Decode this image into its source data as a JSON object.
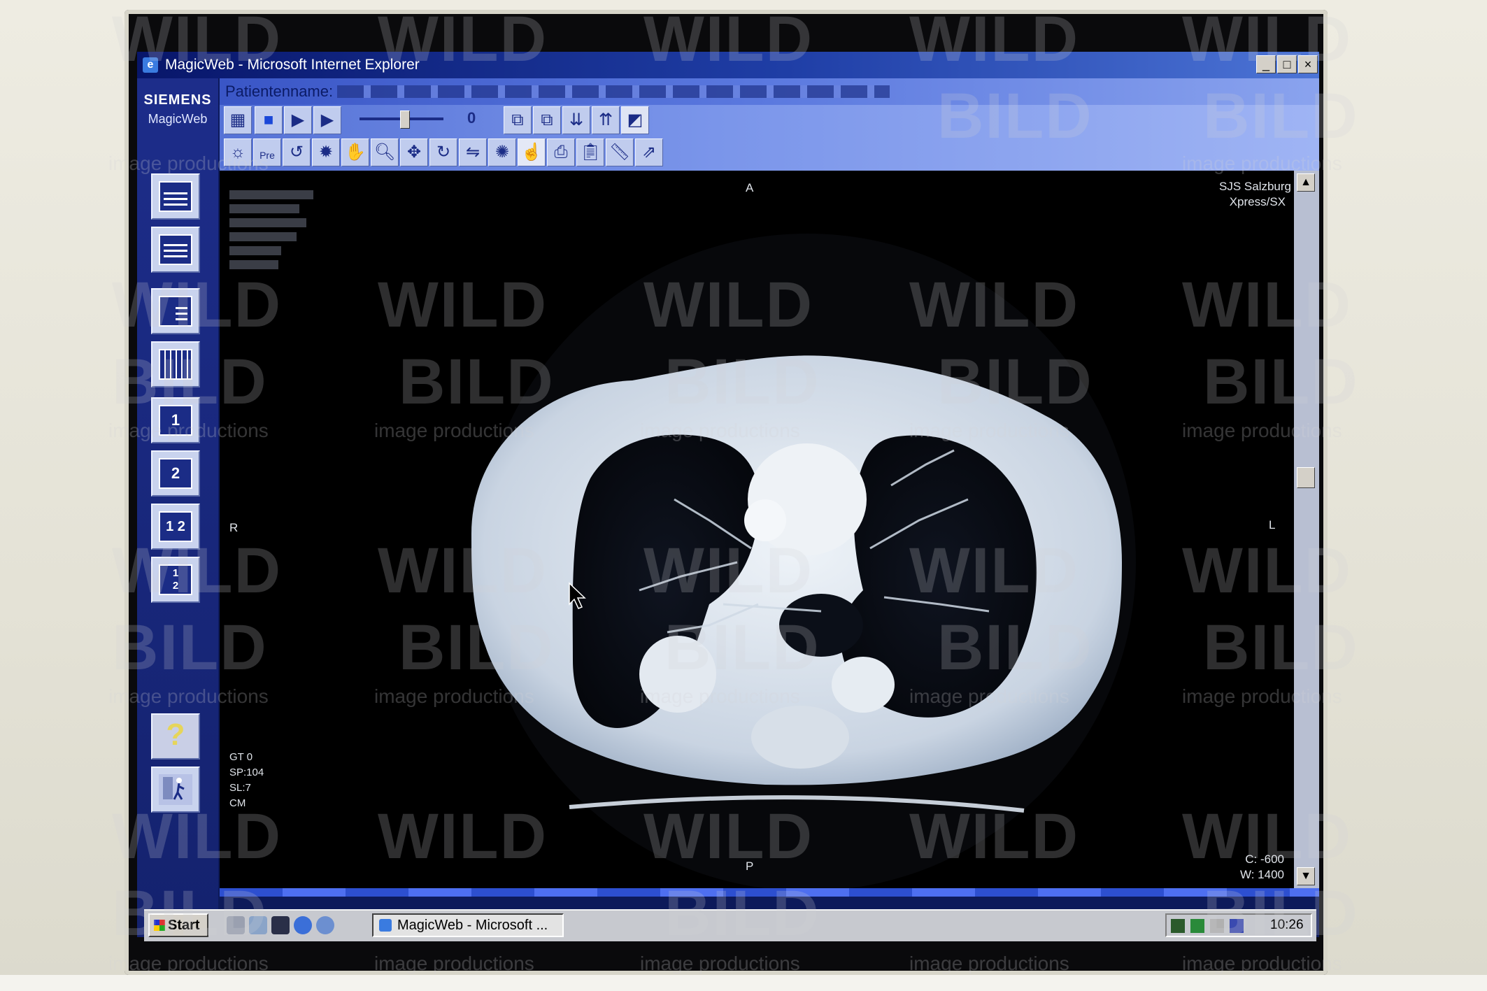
{
  "window": {
    "title": "MagicWeb - Microsoft Internet Explorer",
    "controls": [
      "_",
      "□",
      "×"
    ]
  },
  "sidebar": {
    "brand": "SIEMENS",
    "product": "MagicWeb",
    "layout_buttons": [
      {
        "name": "layout-list",
        "label": ""
      },
      {
        "name": "layout-rows",
        "label": ""
      },
      {
        "name": "layout-split",
        "label": ""
      },
      {
        "name": "layout-grid",
        "label": ""
      },
      {
        "name": "layout-1",
        "label": "1"
      },
      {
        "name": "layout-2",
        "label": "2"
      },
      {
        "name": "layout-1-2",
        "label": "1 2"
      },
      {
        "name": "layout-1-over-2",
        "label": "1\n2"
      }
    ],
    "help_label": "?"
  },
  "header": {
    "patient_label": "Patientenname:"
  },
  "toolbar": {
    "slider_value": "0",
    "pre_label": "Pre"
  },
  "viewport": {
    "institution": "SJS Salzburg",
    "device": "Xpress/SX",
    "orientation_top": "A",
    "orientation_bottom": "P",
    "orientation_left": "R",
    "orientation_right": "L",
    "params": [
      "GT 0",
      "SP:104",
      "SL:7",
      "CM"
    ],
    "window_center": "C: -600",
    "window_width": "W: 1400"
  },
  "taskbar": {
    "start_label": "Start",
    "task_label": "MagicWeb - Microsoft ...",
    "clock": "10:26"
  },
  "watermark": {
    "line1": "WILD",
    "line2": "BILD",
    "line3": "image productions"
  },
  "colors": {
    "titlebar_start": "#08166a",
    "titlebar_end": "#4c74d6",
    "toolbar": "#7a95ea",
    "sidebar": "#1d2d8a",
    "viewport_bg": "#000000"
  }
}
